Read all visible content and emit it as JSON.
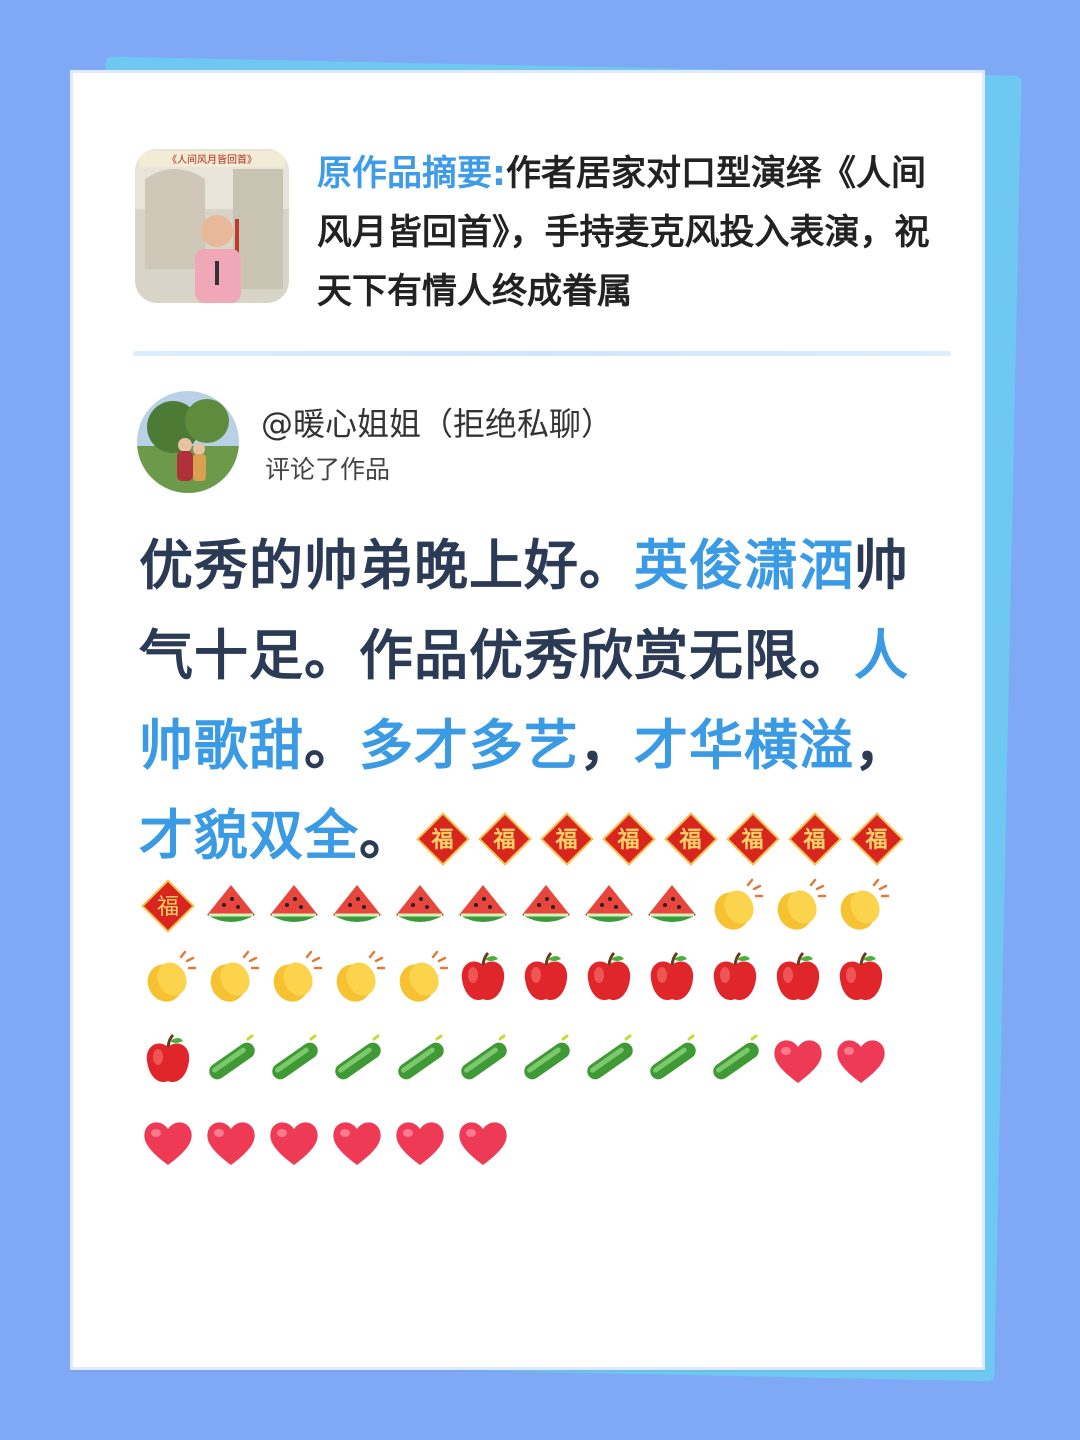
{
  "summary": {
    "label": "原作品摘要:",
    "text": "作者居家对口型演绎《人间风月皆回首》，手持麦克风投入表演，祝天下有情人终成眷属",
    "thumb_caption": "《人间风月皆回首》"
  },
  "comment": {
    "author": "@暖心姐姐（拒绝私聊）",
    "action": "评论了作品",
    "segments": [
      {
        "text": "优秀的帅弟晚上好。",
        "highlight": false
      },
      {
        "text": "英俊潇洒",
        "highlight": true
      },
      {
        "text": "帅气十足。作品优秀欣赏无限。",
        "highlight": false
      },
      {
        "text": "人帅歌甜",
        "highlight": true
      },
      {
        "text": "。",
        "highlight": false
      },
      {
        "text": "多才多艺",
        "highlight": true
      },
      {
        "text": "，",
        "highlight": false
      },
      {
        "text": "才华横溢",
        "highlight": true
      },
      {
        "text": "，",
        "highlight": false
      },
      {
        "text": "才貌双全",
        "highlight": true
      },
      {
        "text": "。",
        "highlight": false
      }
    ],
    "emoji_sequence": [
      {
        "icon": "fu-icon",
        "count": 9
      },
      {
        "icon": "watermelon-icon",
        "count": 8
      },
      {
        "icon": "clapping-hands-icon",
        "count": 8
      },
      {
        "icon": "apple-icon",
        "count": 8
      },
      {
        "icon": "cucumber-icon",
        "count": 9
      },
      {
        "icon": "heart-icon",
        "count": 8
      }
    ]
  },
  "colors": {
    "background": "#7fa8f5",
    "highlight": "#3a9ae4",
    "body_text": "#2b3a55"
  }
}
